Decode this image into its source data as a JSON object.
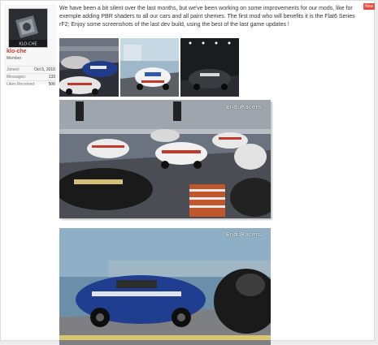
{
  "badge": {
    "new_label": "New"
  },
  "user": {
    "avatar_text": "KLO-CHE",
    "name": "klo-che",
    "title": "Member",
    "stats": [
      {
        "label": "Joined:",
        "value": "Oct 5, 2010"
      },
      {
        "label": "Messages:",
        "value": "133"
      },
      {
        "label": "Likes Received:",
        "value": "506"
      }
    ]
  },
  "message": {
    "text": "We have been a bit silent over the last months, but we've been working on some improvements for our mods, like for exemple adding PBR shaders to all our cars and all paint shemes. The first mod who will benefits it is the Flat6 Series rF2; Enjoy some screenshots of the last dev build, using the best of the last game updates !"
  },
  "images": {
    "watermark": "EnduRacers",
    "count": 5
  },
  "colors": {
    "username": "#c0392b",
    "badge": "#e74c3c",
    "text": "#333333"
  }
}
